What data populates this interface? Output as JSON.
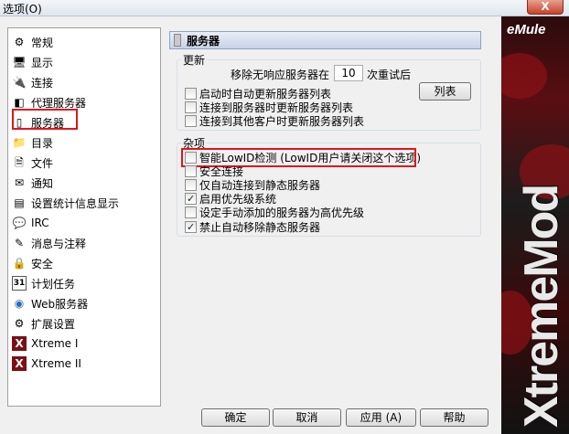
{
  "window": {
    "title": "选项(O)",
    "close_label": "X"
  },
  "brand": {
    "logo": "eMule",
    "vertical_big": "XtremeMod",
    "vertical_small": ""
  },
  "nav": {
    "items": [
      {
        "label": "常规",
        "icon": "gear-icon",
        "glyph": "⚙"
      },
      {
        "label": "显示",
        "icon": "monitor-icon",
        "glyph": "🖥"
      },
      {
        "label": "连接",
        "icon": "connection-icon",
        "glyph": "🔌"
      },
      {
        "label": "代理服务器",
        "icon": "proxy-icon",
        "glyph": "◧"
      },
      {
        "label": "服务器",
        "icon": "server-icon",
        "glyph": "▯"
      },
      {
        "label": "目录",
        "icon": "folder-icon",
        "glyph": "📁"
      },
      {
        "label": "文件",
        "icon": "file-icon",
        "glyph": "🗎"
      },
      {
        "label": "通知",
        "icon": "notify-icon",
        "glyph": "✉"
      },
      {
        "label": "设置统计信息显示",
        "icon": "stats-icon",
        "glyph": "▤"
      },
      {
        "label": "IRC",
        "icon": "irc-icon",
        "glyph": "💬"
      },
      {
        "label": "消息与注释",
        "icon": "messages-icon",
        "glyph": "✎"
      },
      {
        "label": "安全",
        "icon": "lock-icon",
        "glyph": "🔒"
      },
      {
        "label": "计划任务",
        "icon": "calendar-icon",
        "glyph": "31"
      },
      {
        "label": "Web服务器",
        "icon": "globe-icon",
        "glyph": "◉"
      },
      {
        "label": "扩展设置",
        "icon": "extended-icon",
        "glyph": "⚙"
      },
      {
        "label": "Xtreme I",
        "icon": "xtreme-icon",
        "glyph": "X"
      },
      {
        "label": "Xtreme II",
        "icon": "xtreme-icon",
        "glyph": "X"
      }
    ],
    "selected": "服务器"
  },
  "panel": {
    "title": "服务器",
    "update_group": {
      "label": "更新",
      "retry_prefix": "移除无响应服务器在",
      "retry_value": "10",
      "retry_suffix": "次重试后",
      "list_button": "列表",
      "options": [
        {
          "label": "启动时自动更新服务器列表",
          "checked": false
        },
        {
          "label": "连接到服务器时更新服务器列表",
          "checked": false
        },
        {
          "label": "连接到其他客户时更新服务器列表",
          "checked": false
        }
      ]
    },
    "misc_group": {
      "label": "杂项",
      "options": [
        {
          "label": "智能LowID检测 (LowID用户请关闭这个选项)",
          "checked": false
        },
        {
          "label": "安全连接",
          "checked": false
        },
        {
          "label": "仅自动连接到静态服务器",
          "checked": false
        },
        {
          "label": "启用优先级系统",
          "checked": true
        },
        {
          "label": "设定手动添加的服务器为高优先级",
          "checked": false
        },
        {
          "label": "禁止自动移除静态服务器",
          "checked": true
        }
      ]
    }
  },
  "buttons": {
    "ok": "确定",
    "cancel": "取消",
    "apply": "应用 (A)",
    "help": "帮助"
  },
  "colors": {
    "highlight": "#e0161b",
    "header_bg": "#c6d3e6",
    "brand_red": "#8b1117"
  }
}
